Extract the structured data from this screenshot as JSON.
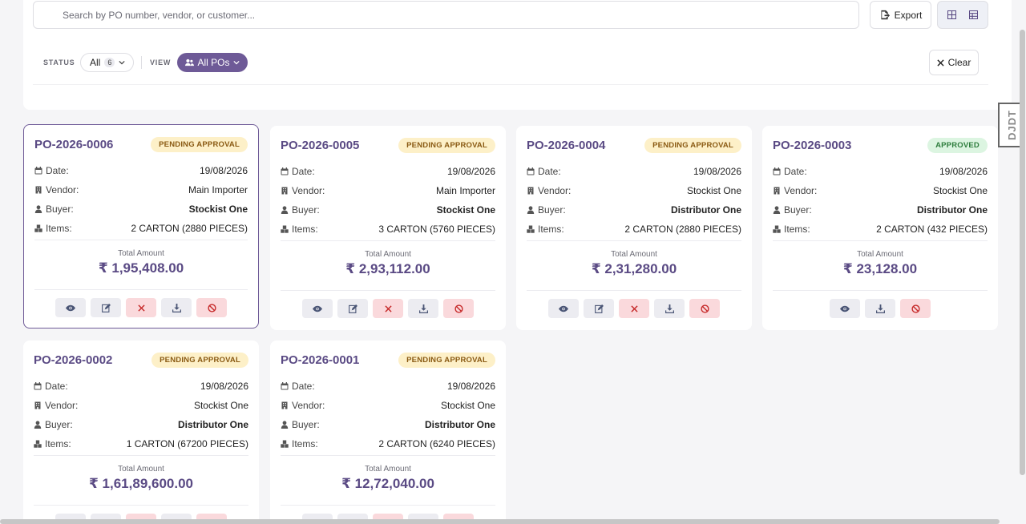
{
  "search": {
    "placeholder": "Search by PO number, vendor, or customer..."
  },
  "toolbar": {
    "export_label": "Export"
  },
  "filters": {
    "status_label": "STATUS",
    "status_value": "All",
    "status_count": "6",
    "view_label": "VIEW",
    "view_value": "All POs",
    "clear_label": "Clear"
  },
  "field_labels": {
    "date": "Date:",
    "vendor": "Vendor:",
    "buyer": "Buyer:",
    "items": "Items:",
    "total": "Total Amount"
  },
  "colors": {
    "accent": "#6e5a97",
    "pending_bg": "#fdf0c8",
    "approved_bg": "#dcf5e1",
    "danger_bg": "#fad9dc"
  },
  "cards": [
    {
      "po": "PO-2026-0006",
      "status": "PENDING APPROVAL",
      "status_type": "pending",
      "date": "19/08/2026",
      "vendor": "Main Importer",
      "buyer": "Stockist One",
      "items": "2 CARTON (2880 PIECES)",
      "total": "₹ 1,95,408.00",
      "actions": [
        "view",
        "edit",
        "reject",
        "download",
        "cancel"
      ]
    },
    {
      "po": "PO-2026-0005",
      "status": "PENDING APPROVAL",
      "status_type": "pending",
      "date": "19/08/2026",
      "vendor": "Main Importer",
      "buyer": "Stockist One",
      "items": "3 CARTON (5760 PIECES)",
      "total": "₹ 2,93,112.00",
      "actions": [
        "view",
        "edit",
        "reject",
        "download",
        "cancel"
      ]
    },
    {
      "po": "PO-2026-0004",
      "status": "PENDING APPROVAL",
      "status_type": "pending",
      "date": "19/08/2026",
      "vendor": "Stockist One",
      "buyer": "Distributor One",
      "items": "2 CARTON (2880 PIECES)",
      "total": "₹ 2,31,280.00",
      "actions": [
        "view",
        "edit",
        "reject",
        "download",
        "cancel"
      ]
    },
    {
      "po": "PO-2026-0003",
      "status": "APPROVED",
      "status_type": "approved",
      "date": "19/08/2026",
      "vendor": "Stockist One",
      "buyer": "Distributor One",
      "items": "2 CARTON (432 PIECES)",
      "total": "₹ 23,128.00",
      "actions": [
        "view",
        "download",
        "cancel"
      ]
    },
    {
      "po": "PO-2026-0002",
      "status": "PENDING APPROVAL",
      "status_type": "pending",
      "date": "19/08/2026",
      "vendor": "Stockist One",
      "buyer": "Distributor One",
      "items": "1 CARTON (67200 PIECES)",
      "total": "₹ 1,61,89,600.00",
      "actions": [
        "view",
        "edit",
        "reject",
        "download",
        "cancel"
      ]
    },
    {
      "po": "PO-2026-0001",
      "status": "PENDING APPROVAL",
      "status_type": "pending",
      "date": "19/08/2026",
      "vendor": "Stockist One",
      "buyer": "Distributor One",
      "items": "2 CARTON (6240 PIECES)",
      "total": "₹ 12,72,040.00",
      "actions": [
        "view",
        "edit",
        "reject",
        "download",
        "cancel"
      ]
    }
  ],
  "debug_toolbar": {
    "label": "DJDT"
  }
}
